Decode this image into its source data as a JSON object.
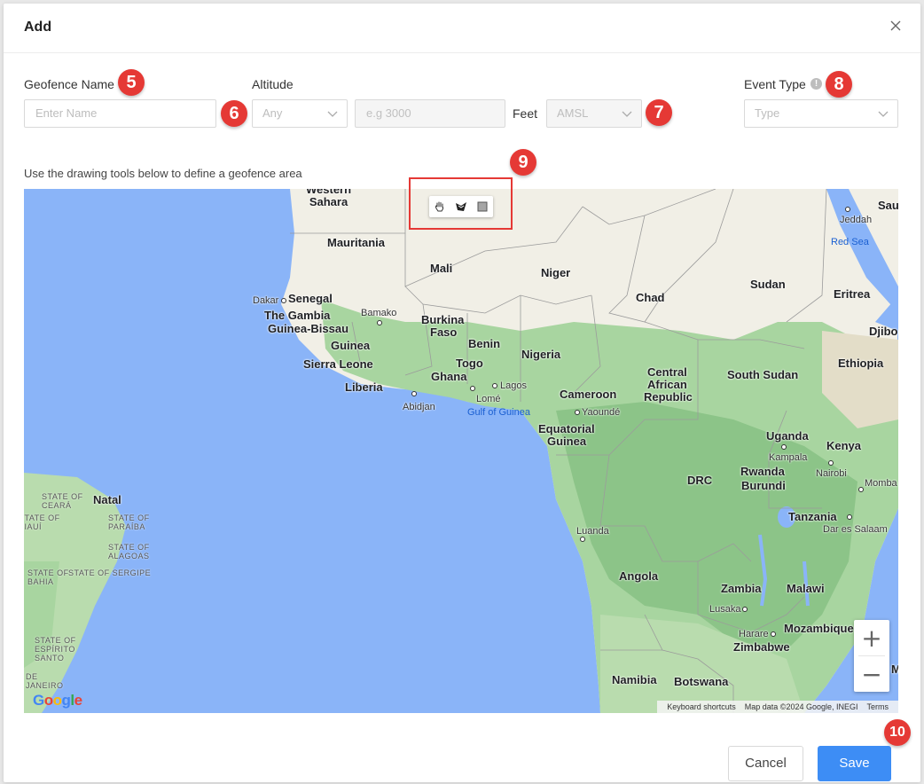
{
  "dialog": {
    "title": "Add",
    "close_icon": "close-icon"
  },
  "form": {
    "geofence_name_label": "Geofence Name",
    "geofence_name_placeholder": "Enter Name",
    "altitude_label": "Altitude",
    "altitude_select_value": "Any",
    "altitude_value_placeholder": "e.g 3000",
    "unit_label": "Feet",
    "reference_select_value": "AMSL",
    "event_type_label": "Event Type",
    "event_type_placeholder": "Type",
    "hint": "Use the drawing tools below to define a geofence area"
  },
  "badges": {
    "b5": "5",
    "b6": "6",
    "b7": "7",
    "b8": "8",
    "b9": "9",
    "b10": "10"
  },
  "map": {
    "drawing_tools": [
      "hand-icon",
      "polygon-icon",
      "rectangle-icon"
    ],
    "countries": {
      "western_sahara": "Western\nSahara",
      "mauritania": "Mauritania",
      "mali": "Mali",
      "niger": "Niger",
      "chad": "Chad",
      "sudan": "Sudan",
      "eritrea": "Eritrea",
      "djibouti": "Djibo",
      "ethiopia": "Ethiopia",
      "senegal": "Senegal",
      "gambia": "The Gambia",
      "guinea_bissau": "Guinea-Bissau",
      "guinea": "Guinea",
      "sierra_leone": "Sierra Leone",
      "liberia": "Liberia",
      "burkina": "Burkina",
      "faso": "Faso",
      "benin": "Benin",
      "togo": "Togo",
      "ghana": "Ghana",
      "nigeria": "Nigeria",
      "cameroon": "Cameroon",
      "car1": "Central",
      "car2": "African",
      "car3": "Republic",
      "south_sudan": "South Sudan",
      "eq_guinea1": "Equatorial",
      "eq_guinea2": "Guinea",
      "uganda": "Uganda",
      "kenya": "Kenya",
      "drc": "DRC",
      "rwanda": "Rwanda",
      "burundi": "Burundi",
      "tanzania": "Tanzania",
      "angola": "Angola",
      "zambia": "Zambia",
      "malawi": "Malawi",
      "mozambique": "Mozambique",
      "zimbabwe": "Zimbabwe",
      "namibia": "Namibia",
      "botswana": "Botswana",
      "natal": "Natal",
      "saudi": "Sau",
      "m_edge": "M"
    },
    "cities": {
      "dakar": "Dakar",
      "bamako": "Bamako",
      "abidjan": "Abidjan",
      "lome": "Lomé",
      "lagos": "Lagos",
      "yaounde": "Yaoundé",
      "kampala": "Kampala",
      "nairobi": "Nairobi",
      "mombasa": "Momba",
      "dar": "Dar es Salaam",
      "luanda": "Luanda",
      "lusaka": "Lusaka",
      "harare": "Harare",
      "jeddah": "Jeddah"
    },
    "water": {
      "gulf_guinea": "Gulf of Guinea",
      "red_sea": "Red Sea"
    },
    "states": {
      "ceara": "STATE OF\nCEARÁ",
      "piaui": "STATE OF\nPIAUÍ",
      "paraiba": "STATE OF\nPARAÍBA",
      "alagoas": "STATE OF\nALAGOAS",
      "sergipe": "STATE OF SERGIPE",
      "bahia": "STATE OF\nBAHIA",
      "espirito": "STATE OF\nESPÍRITO\nSANTO",
      "rio": "DE\nJANEIRO"
    },
    "zoom_in": "+",
    "zoom_out": "−",
    "google_logo": "Google",
    "attribution": {
      "shortcuts": "Keyboard shortcuts",
      "map_data": "Map data ©2024 Google, INEGI",
      "terms": "Terms"
    }
  },
  "footer": {
    "cancel": "Cancel",
    "save": "Save"
  }
}
